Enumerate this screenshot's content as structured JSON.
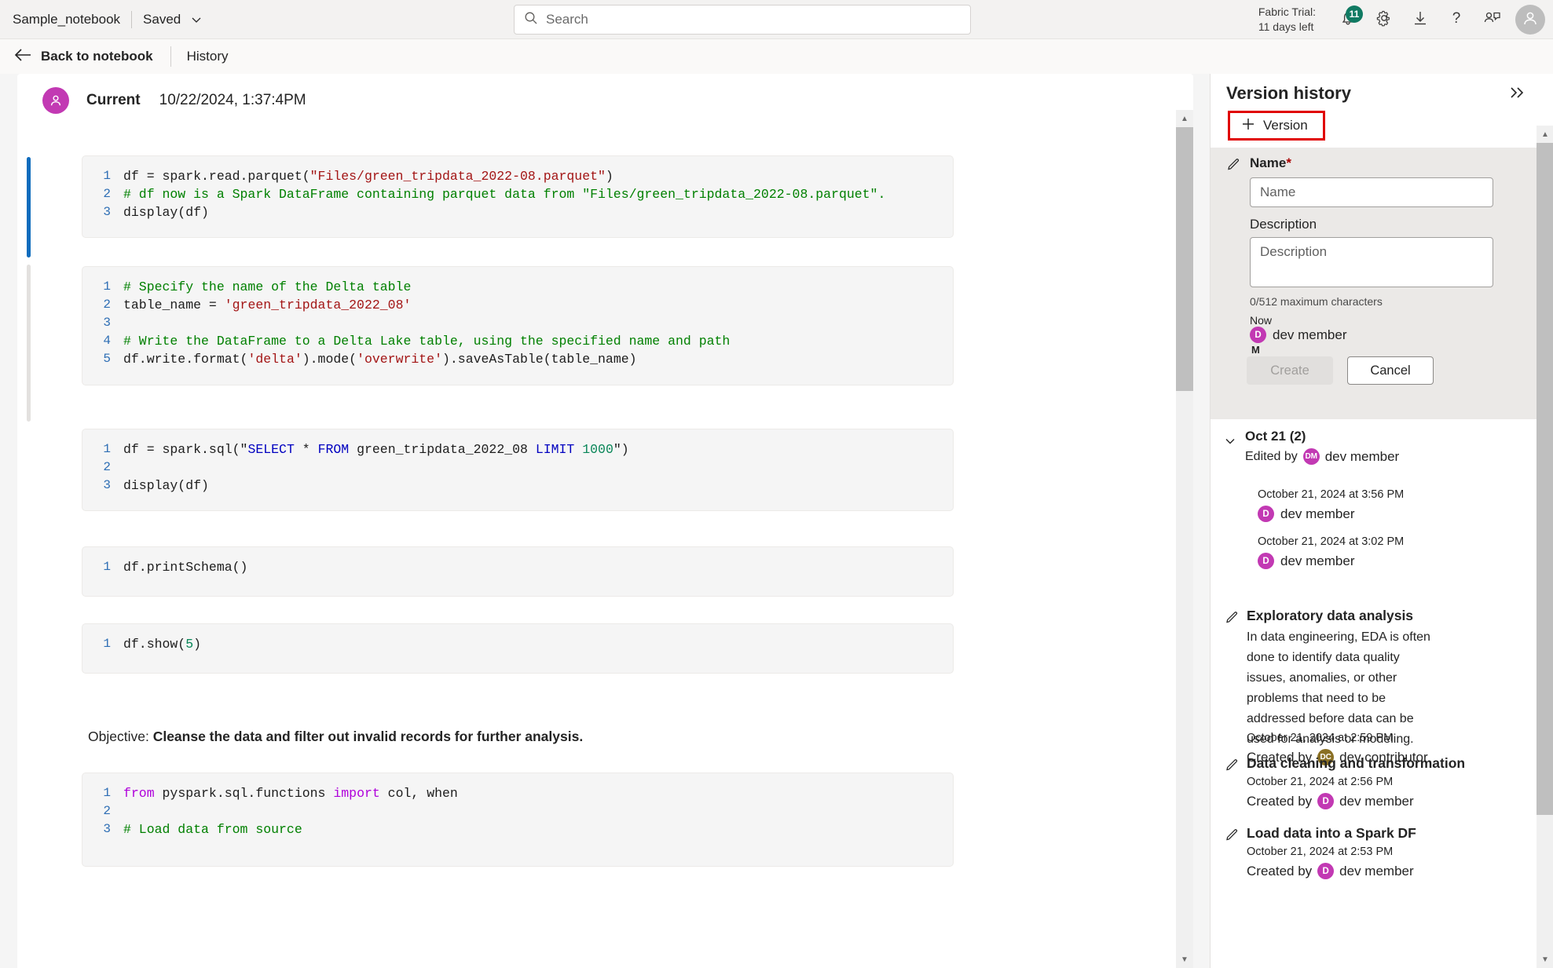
{
  "topbar": {
    "notebook_title": "Sample_notebook",
    "saved_label": "Saved",
    "chevron_icon": "chevron-down-icon",
    "search_placeholder": "Search",
    "search_value": "",
    "search_icon": "search-icon",
    "trial_line1": "Fabric Trial:",
    "trial_line2": "11 days left",
    "notification_count": "11",
    "notification_icon": "bell-icon",
    "settings_icon": "gear-icon",
    "download_icon": "download-icon",
    "help_icon": "question-mark-icon",
    "feedback_icon": "feedback-icon",
    "account_icon": "person-avatar-icon",
    "badge_color": "#107a62"
  },
  "subbar": {
    "back_label": "Back to notebook",
    "back_icon": "arrow-left-icon",
    "history_label": "History"
  },
  "current": {
    "avatar_icon": "person-icon",
    "avatar_color": "#c239b3",
    "label": "Current",
    "timestamp": "10/22/2024, 1:37:4PM"
  },
  "notebook": {
    "cells": [
      {
        "type": "code",
        "active": true,
        "lines": [
          [
            {
              "t": "df = spark.read.parquet(",
              "c": "code"
            },
            {
              "t": "\"Files/green_tripdata_2022-08.parquet\"",
              "c": "c-str"
            },
            {
              "t": ")",
              "c": "code"
            }
          ],
          [
            {
              "t": "# df now is a Spark DataFrame containing parquet data from \"Files/green_tripdata_2022-08.parquet\".",
              "c": "c-com"
            }
          ],
          [
            {
              "t": "display(df)",
              "c": "code"
            }
          ]
        ]
      },
      {
        "type": "code",
        "active": false,
        "lines": [
          [
            {
              "t": "# Specify the name of the Delta table",
              "c": "c-com"
            }
          ],
          [
            {
              "t": "table_name = ",
              "c": "code"
            },
            {
              "t": "'green_tripdata_2022_08'",
              "c": "c-str"
            }
          ],
          [
            {
              "t": "",
              "c": "code"
            }
          ],
          [
            {
              "t": "# Write the DataFrame to a Delta Lake table, using the specified name and path",
              "c": "c-com"
            }
          ],
          [
            {
              "t": "df.write.format(",
              "c": "code"
            },
            {
              "t": "'delta'",
              "c": "c-str"
            },
            {
              "t": ").mode(",
              "c": "code"
            },
            {
              "t": "'overwrite'",
              "c": "c-str"
            },
            {
              "t": ").saveAsTable(table_name)",
              "c": "code"
            }
          ]
        ]
      },
      {
        "type": "code",
        "active": false,
        "lines": [
          [
            {
              "t": "df = spark.sql(\"",
              "c": "code"
            },
            {
              "t": "SELECT",
              "c": "c-kw"
            },
            {
              "t": " * ",
              "c": "code"
            },
            {
              "t": "FROM",
              "c": "c-kw"
            },
            {
              "t": " green_tripdata_2022_08 ",
              "c": "code"
            },
            {
              "t": "LIMIT",
              "c": "c-kw"
            },
            {
              "t": " ",
              "c": "code"
            },
            {
              "t": "1000",
              "c": "c-num"
            },
            {
              "t": "\")",
              "c": "code"
            }
          ],
          [
            {
              "t": "",
              "c": "code"
            }
          ],
          [
            {
              "t": "display(df)",
              "c": "code"
            }
          ]
        ]
      },
      {
        "type": "code",
        "active": false,
        "lines": [
          [
            {
              "t": "df.printSchema()",
              "c": "code"
            }
          ]
        ]
      },
      {
        "type": "code",
        "active": false,
        "lines": [
          [
            {
              "t": "df.show(",
              "c": "code"
            },
            {
              "t": "5",
              "c": "c-num"
            },
            {
              "t": ")",
              "c": "code"
            }
          ]
        ]
      },
      {
        "type": "markdown",
        "active": false,
        "prefix": "Objective: ",
        "bold": "Cleanse the data and filter out invalid records for further analysis."
      },
      {
        "type": "code",
        "active": false,
        "lines": [
          [
            {
              "t": "from",
              "c": "c-imp"
            },
            {
              "t": " pyspark.sql.functions ",
              "c": "code"
            },
            {
              "t": "import",
              "c": "c-imp"
            },
            {
              "t": " col, when",
              "c": "code"
            }
          ],
          [
            {
              "t": "",
              "c": "code"
            }
          ],
          [
            {
              "t": "# Load data from source",
              "c": "c-com"
            }
          ]
        ]
      }
    ]
  },
  "panel": {
    "title": "Version history",
    "collapse_icon": "chevron-double-right-icon",
    "version_button_label": "Version",
    "version_button_icon": "plus-icon",
    "version_button_border": "#e00000",
    "form": {
      "pencil_icon": "pencil-icon",
      "name_label": "Name",
      "name_required": "*",
      "name_placeholder": "Name",
      "name_value": "",
      "description_label": "Description",
      "description_placeholder": "Description",
      "description_value": "",
      "counter": "0/512 maximum characters",
      "now_label": "Now",
      "author": "dev member",
      "author_initial": "D",
      "author_color": "#c239b3",
      "author_secondary_initial": "M",
      "create_label": "Create",
      "cancel_label": "Cancel"
    },
    "groups": [
      {
        "title": "Oct 21 (2)",
        "chevron_icon": "chevron-down-icon",
        "edited_by_prefix": "Edited by",
        "edited_by_name": "dev member",
        "edited_by_initials": "DM",
        "edited_by_color": "#c239b3",
        "entries": [
          {
            "date": "October 21, 2024 at 3:56 PM",
            "author": "dev member",
            "initial": "D",
            "color": "#c239b3"
          },
          {
            "date": "October 21, 2024 at 3:02 PM",
            "author": "dev member",
            "initial": "D",
            "color": "#c239b3"
          }
        ]
      }
    ],
    "versions": [
      {
        "pencil_icon": "pencil-icon",
        "title": "Exploratory data analysis",
        "description": "In data engineering, EDA is often done to identify data quality issues, anomalies, or other problems that need to be addressed before data can be used for analysis or modeling.",
        "date": "October 21, 2024 at 2:59 PM",
        "created_by_prefix": "Created by",
        "author": "dev contributor",
        "initials": "DC",
        "color": "#8a7024"
      },
      {
        "pencil_icon": "pencil-icon",
        "title": "Data cleaning and transformation",
        "description": "",
        "date": "October 21, 2024 at 2:56 PM",
        "created_by_prefix": "Created by",
        "author": "dev member",
        "initials": "D",
        "color": "#c239b3"
      },
      {
        "pencil_icon": "pencil-icon",
        "title": "Load data into a Spark DF",
        "description": "",
        "date": "October 21, 2024 at 2:53 PM",
        "created_by_prefix": "Created by",
        "author": "dev member",
        "initials": "D",
        "color": "#c239b3"
      }
    ]
  }
}
